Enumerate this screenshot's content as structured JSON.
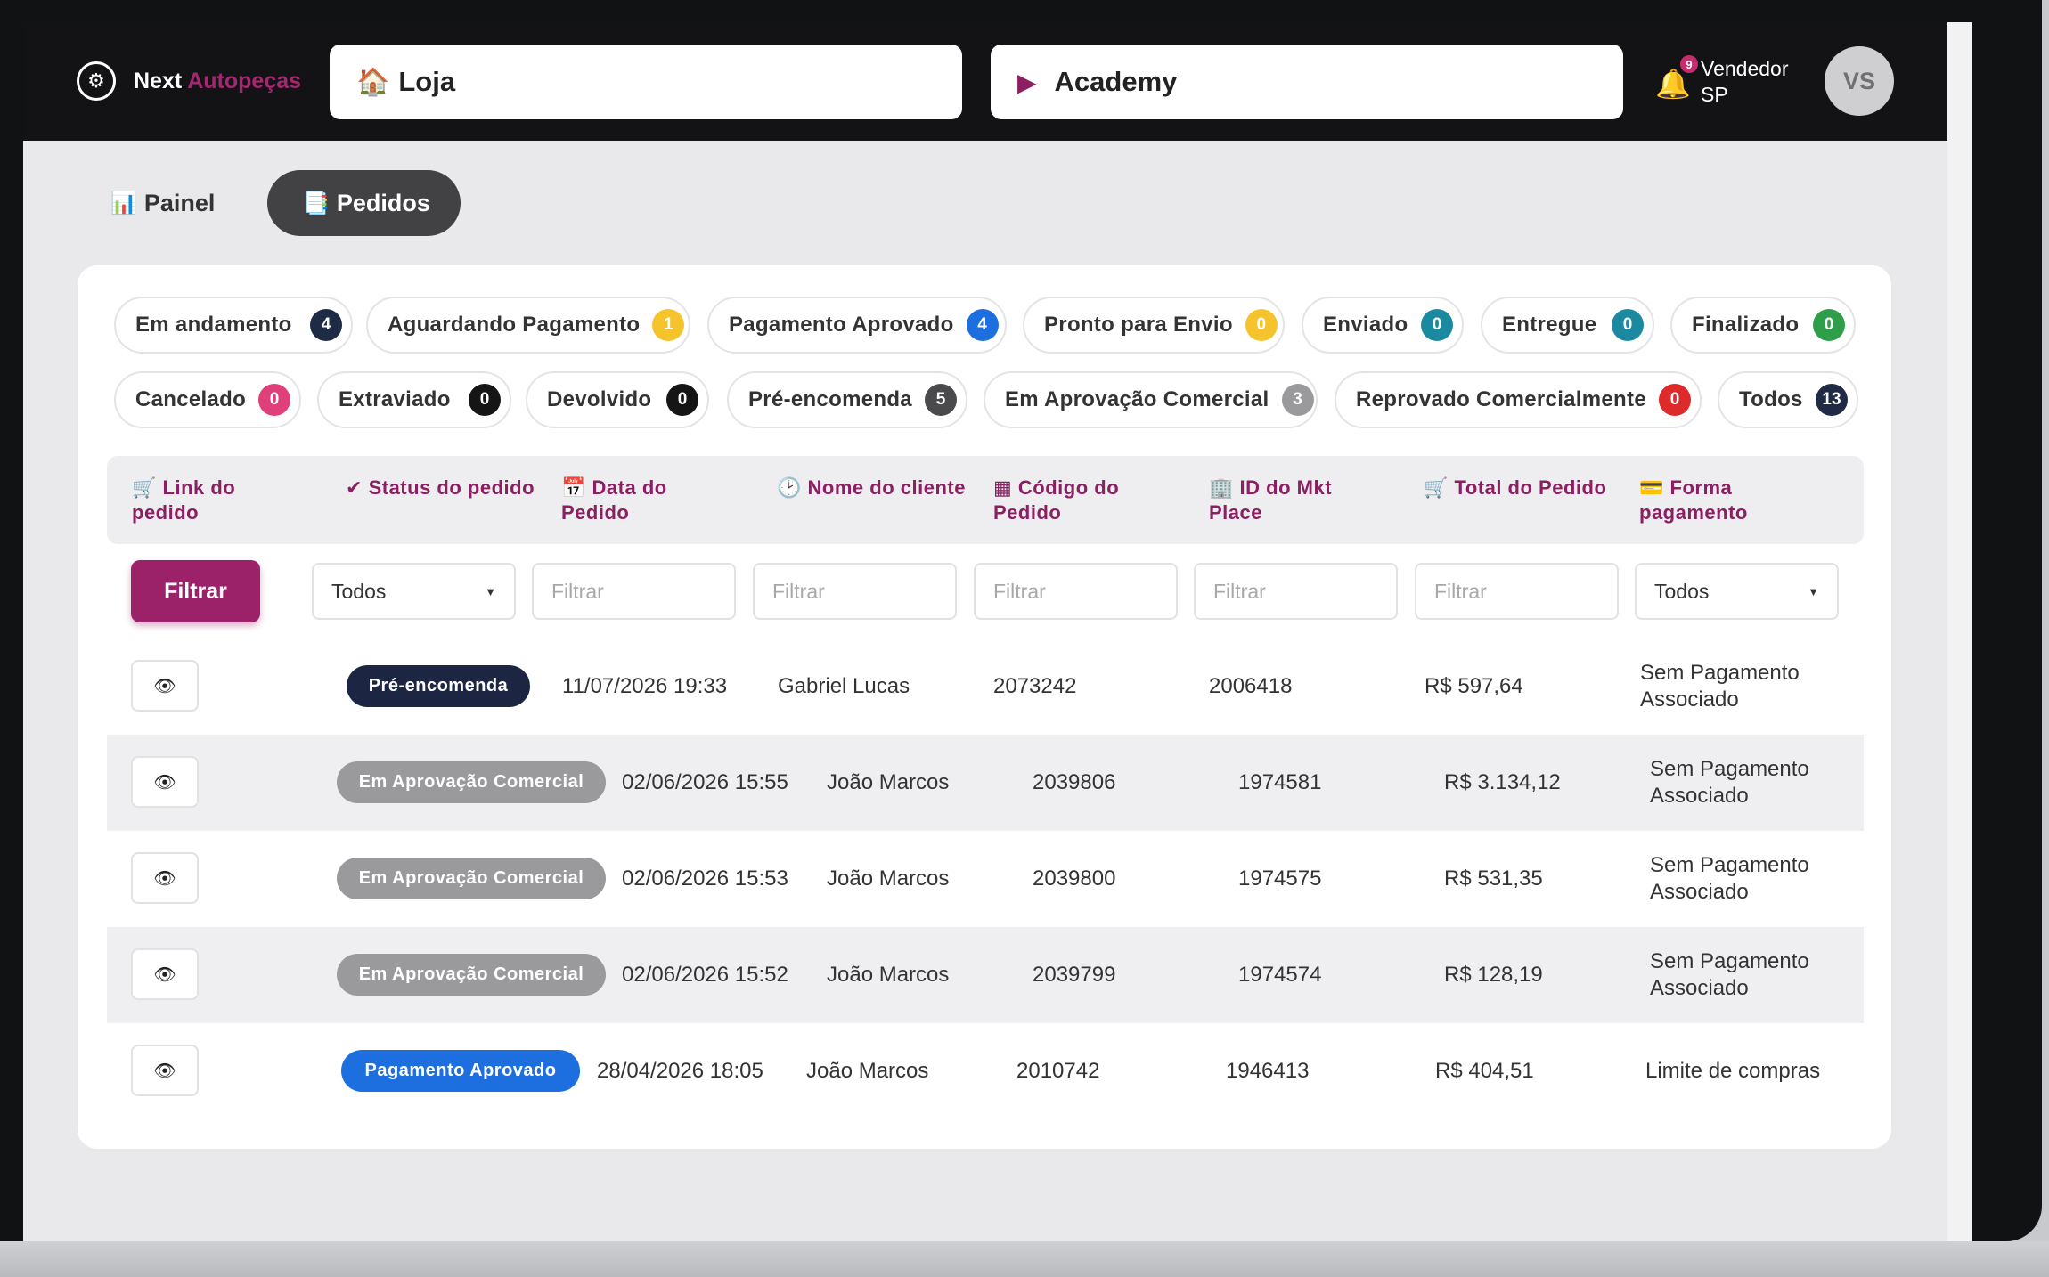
{
  "header": {
    "brand_icon": "gear-icon",
    "brand_primary": "Next",
    "brand_accent": "Autopeças",
    "store_label": "Loja",
    "store_icon": "house-icon",
    "academy_label": "Academy",
    "academy_icon": "play-icon",
    "notification_count": "9",
    "user_name_line1": "Vendedor",
    "user_name_line2": "SP",
    "avatar_initials": "VS"
  },
  "nav": {
    "tabs": [
      {
        "label": "Painel",
        "icon": "📊",
        "active": false
      },
      {
        "label": "Pedidos",
        "icon": "📑",
        "active": true
      }
    ]
  },
  "status_chips": [
    {
      "label": "Em andamento",
      "count": "4",
      "color": "#1f2a44"
    },
    {
      "label": "Aguardando Pagamento",
      "count": "1",
      "color": "#f5c32c"
    },
    {
      "label": "Pagamento Aprovado",
      "count": "4",
      "color": "#1d6fe0"
    },
    {
      "label": "Pronto para Envio",
      "count": "0",
      "color": "#f5c32c"
    },
    {
      "label": "Enviado",
      "count": "0",
      "color": "#1b8aa0"
    },
    {
      "label": "Entregue",
      "count": "0",
      "color": "#1b8aa0"
    },
    {
      "label": "Finalizado",
      "count": "0",
      "color": "#2e9e4a"
    },
    {
      "label": "Cancelado",
      "count": "0",
      "color": "#e0407a"
    },
    {
      "label": "Extraviado",
      "count": "0",
      "color": "#151515"
    },
    {
      "label": "Devolvido",
      "count": "0",
      "color": "#151515"
    },
    {
      "label": "Pré-encomenda",
      "count": "5",
      "color": "#4a4a4c"
    },
    {
      "label": "Em Aprovação Comercial",
      "count": "3",
      "color": "#9a9a9c"
    },
    {
      "label": "Reprovado Comercialmente",
      "count": "0",
      "color": "#dd2a2a"
    },
    {
      "label": "Todos",
      "count": "13",
      "color": "#1f2a44"
    }
  ],
  "table": {
    "columns": [
      {
        "icon": "🛒",
        "label": "Link do pedido"
      },
      {
        "icon": "✔",
        "label": "Status do pedido"
      },
      {
        "icon": "📅",
        "label": "Data do Pedido"
      },
      {
        "icon": "🕑",
        "label": "Nome do cliente"
      },
      {
        "icon": "▦",
        "label": "Código do Pedido"
      },
      {
        "icon": "🏢",
        "label": "ID do Mkt Place"
      },
      {
        "icon": "🛒",
        "label": "Total do Pedido"
      },
      {
        "icon": "💳",
        "label": "Forma pagamento"
      }
    ],
    "filter_button": "Filtrar",
    "filters": {
      "status_select": "Todos",
      "date_placeholder": "Filtrar",
      "client_placeholder": "Filtrar",
      "code_placeholder": "Filtrar",
      "mkt_placeholder": "Filtrar",
      "total_placeholder": "Filtrar",
      "payment_select": "Todos"
    },
    "view_icon": "eye-icon",
    "rows": [
      {
        "status": "Pré-encomenda",
        "status_color": "#1c2643",
        "date": "11/07/2026 19:33",
        "client": "Gabriel Lucas",
        "code": "2073242",
        "mkt_id": "2006418",
        "total": "R$ 597,64",
        "payment": "Sem Pagamento Associado"
      },
      {
        "status": "Em Aprovação Comercial",
        "status_color": "#9a9a9c",
        "date": "02/06/2026 15:55",
        "client": "João Marcos",
        "code": "2039806",
        "mkt_id": "1974581",
        "total": "R$ 3.134,12",
        "payment": "Sem Pagamento Associado"
      },
      {
        "status": "Em Aprovação Comercial",
        "status_color": "#9a9a9c",
        "date": "02/06/2026 15:53",
        "client": "João Marcos",
        "code": "2039800",
        "mkt_id": "1974575",
        "total": "R$ 531,35",
        "payment": "Sem Pagamento Associado"
      },
      {
        "status": "Em Aprovação Comercial",
        "status_color": "#9a9a9c",
        "date": "02/06/2026 15:52",
        "client": "João Marcos",
        "code": "2039799",
        "mkt_id": "1974574",
        "total": "R$ 128,19",
        "payment": "Sem Pagamento Associado"
      },
      {
        "status": "Pagamento Aprovado",
        "status_color": "#1d6fe0",
        "date": "28/04/2026 18:05",
        "client": "João Marcos",
        "code": "2010742",
        "mkt_id": "1946413",
        "total": "R$ 404,51",
        "payment": "Limite de compras"
      }
    ]
  }
}
